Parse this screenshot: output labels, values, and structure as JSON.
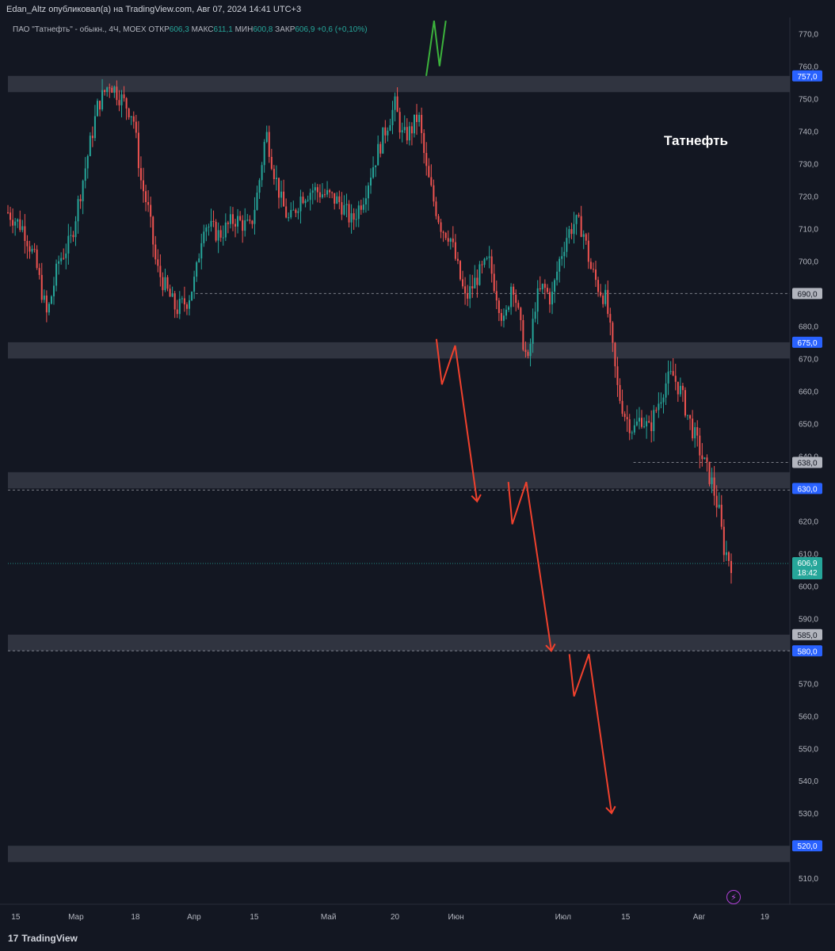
{
  "header": {
    "publisher": "Edan_Altz опубликовал(а) на TradingView.com, Авг 07, 2024 14:41 UTC+3"
  },
  "legend": {
    "symbol": "ПАО \"Татнефть\" - обыкн., 4Ч, MOEX",
    "open_label": "ОТКР",
    "open_value": "606,3",
    "high_label": "МАКС",
    "high_value": "611,1",
    "low_label": "МИН",
    "low_value": "600,8",
    "close_label": "ЗАКР",
    "close_value": "606,9",
    "change": "+0,6 (+0,10%)"
  },
  "annotation_title": "Татнефть",
  "footer": {
    "brand": "TradingView",
    "logo": "17"
  },
  "colors": {
    "background": "#131722",
    "up": "#26a69a",
    "down": "#ef5350",
    "zone": "#363a45",
    "level_blue": "#2962ff",
    "level_gray": "#b2b5be",
    "arrow_red": "#f0412d",
    "arrow_green": "#3cb33c"
  },
  "chart_data": {
    "type": "candlestick",
    "title": "ПАО \"Татнефть\" - обыкн., 4Ч, MOEX",
    "ylim": [
      502,
      775
    ],
    "y_ticks": [
      "510,0",
      "520,0",
      "530,0",
      "540,0",
      "550,0",
      "560,0",
      "570,0",
      "580,0",
      "590,0",
      "600,0",
      "610,0",
      "620,0",
      "630,0",
      "640,0",
      "650,0",
      "660,0",
      "670,0",
      "680,0",
      "690,0",
      "700,0",
      "710,0",
      "720,0",
      "730,0",
      "740,0",
      "750,0",
      "760,0",
      "770,0"
    ],
    "x_ticks": [
      "15",
      "Мар",
      "18",
      "Апр",
      "15",
      "Май",
      "20",
      "Июн",
      "Июл",
      "15",
      "Авг",
      "19"
    ],
    "price_path": [
      [
        0,
        715
      ],
      [
        0.02,
        710
      ],
      [
        0.035,
        700
      ],
      [
        0.05,
        683
      ],
      [
        0.065,
        700
      ],
      [
        0.08,
        706
      ],
      [
        0.1,
        730
      ],
      [
        0.115,
        748
      ],
      [
        0.13,
        755
      ],
      [
        0.145,
        750
      ],
      [
        0.16,
        745
      ],
      [
        0.17,
        725
      ],
      [
        0.18,
        715
      ],
      [
        0.19,
        698
      ],
      [
        0.205,
        690
      ],
      [
        0.215,
        685
      ],
      [
        0.23,
        688
      ],
      [
        0.24,
        695
      ],
      [
        0.25,
        712
      ],
      [
        0.27,
        708
      ],
      [
        0.29,
        713
      ],
      [
        0.31,
        710
      ],
      [
        0.32,
        722
      ],
      [
        0.33,
        740
      ],
      [
        0.34,
        728
      ],
      [
        0.35,
        718
      ],
      [
        0.36,
        712
      ],
      [
        0.375,
        720
      ],
      [
        0.39,
        722
      ],
      [
        0.41,
        720
      ],
      [
        0.425,
        718
      ],
      [
        0.44,
        712
      ],
      [
        0.455,
        720
      ],
      [
        0.465,
        728
      ],
      [
        0.475,
        735
      ],
      [
        0.485,
        742
      ],
      [
        0.495,
        748
      ],
      [
        0.505,
        738
      ],
      [
        0.515,
        740
      ],
      [
        0.525,
        745
      ],
      [
        0.535,
        728
      ],
      [
        0.545,
        718
      ],
      [
        0.555,
        710
      ],
      [
        0.565,
        708
      ],
      [
        0.575,
        698
      ],
      [
        0.585,
        688
      ],
      [
        0.6,
        695
      ],
      [
        0.615,
        700
      ],
      [
        0.625,
        690
      ],
      [
        0.635,
        680
      ],
      [
        0.645,
        695
      ],
      [
        0.655,
        680
      ],
      [
        0.665,
        668
      ],
      [
        0.675,
        688
      ],
      [
        0.685,
        692
      ],
      [
        0.695,
        688
      ],
      [
        0.705,
        700
      ],
      [
        0.715,
        708
      ],
      [
        0.725,
        712
      ],
      [
        0.735,
        710
      ],
      [
        0.745,
        698
      ],
      [
        0.755,
        692
      ],
      [
        0.765,
        688
      ],
      [
        0.772,
        675
      ],
      [
        0.78,
        660
      ],
      [
        0.79,
        652
      ],
      [
        0.8,
        648
      ],
      [
        0.81,
        652
      ],
      [
        0.82,
        648
      ],
      [
        0.83,
        655
      ],
      [
        0.84,
        662
      ],
      [
        0.85,
        665
      ],
      [
        0.86,
        660
      ],
      [
        0.87,
        652
      ],
      [
        0.88,
        645
      ],
      [
        0.89,
        638
      ],
      [
        0.9,
        632
      ],
      [
        0.91,
        622
      ],
      [
        0.915,
        612
      ],
      [
        0.925,
        606.9
      ]
    ],
    "current_price": "606,9",
    "countdown": "18:42",
    "zones": [
      {
        "low": 752,
        "high": 757
      },
      {
        "low": 670,
        "high": 675
      },
      {
        "low": 630,
        "high": 635
      },
      {
        "low": 580,
        "high": 585
      },
      {
        "low": 515,
        "high": 520
      }
    ],
    "labelled_levels": [
      {
        "value": 757,
        "label": "757,0",
        "style": "blue"
      },
      {
        "value": 690,
        "label": "690,0",
        "style": "gray"
      },
      {
        "value": 675,
        "label": "675,0",
        "style": "blue"
      },
      {
        "value": 638,
        "label": "638,0",
        "style": "gray"
      },
      {
        "value": 630,
        "label": "630,0",
        "style": "blue"
      },
      {
        "value": 585,
        "label": "585,0",
        "style": "gray"
      },
      {
        "value": 580,
        "label": "580,0",
        "style": "blue"
      },
      {
        "value": 520,
        "label": "520,0",
        "style": "blue"
      }
    ],
    "dashed_levels": [
      {
        "value": 690,
        "from": 0.24,
        "to": 1.0
      },
      {
        "value": 638,
        "from": 0.8,
        "to": 1.0
      },
      {
        "value": 629.5,
        "from": 0.0,
        "to": 1.0
      },
      {
        "value": 580,
        "from": 0.0,
        "to": 1.0
      },
      {
        "value": 606.9,
        "from": 0.0,
        "to": 1.0,
        "dotted": true
      }
    ],
    "projection_red": [
      [
        0.548,
        676
      ],
      [
        0.555,
        662
      ],
      [
        0.572,
        674
      ],
      [
        0.6,
        626
      ],
      [
        0.64,
        632
      ],
      [
        0.645,
        619
      ],
      [
        0.663,
        632
      ],
      [
        0.695,
        580
      ],
      [
        0.718,
        579
      ],
      [
        0.724,
        566
      ],
      [
        0.743,
        579
      ],
      [
        0.772,
        530
      ]
    ],
    "projection_green": [
      [
        0.535,
        757
      ],
      [
        0.545,
        774
      ],
      [
        0.552,
        760
      ],
      [
        0.56,
        774
      ]
    ]
  }
}
